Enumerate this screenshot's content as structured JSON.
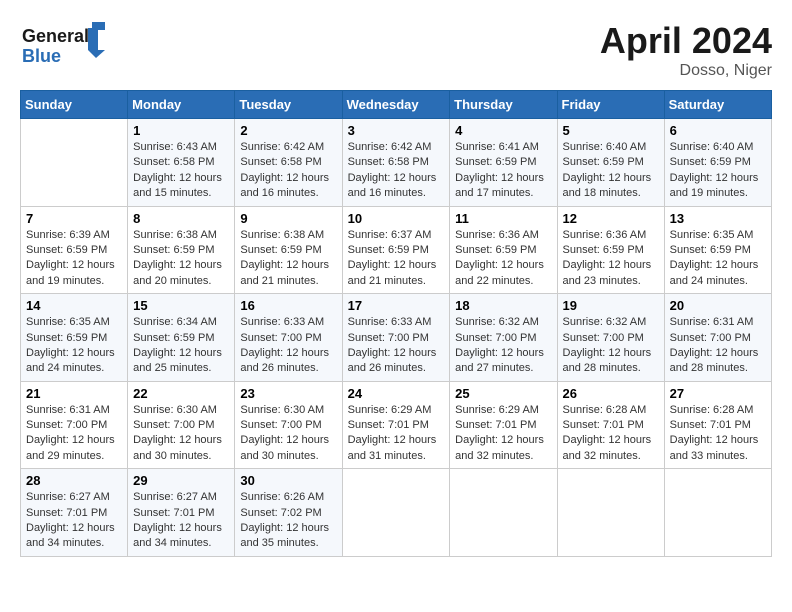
{
  "header": {
    "logo_line1": "General",
    "logo_line2": "Blue",
    "month": "April 2024",
    "location": "Dosso, Niger"
  },
  "days_of_week": [
    "Sunday",
    "Monday",
    "Tuesday",
    "Wednesday",
    "Thursday",
    "Friday",
    "Saturday"
  ],
  "weeks": [
    [
      {
        "day": "",
        "sunrise": "",
        "sunset": "",
        "daylight": ""
      },
      {
        "day": "1",
        "sunrise": "Sunrise: 6:43 AM",
        "sunset": "Sunset: 6:58 PM",
        "daylight": "Daylight: 12 hours and 15 minutes."
      },
      {
        "day": "2",
        "sunrise": "Sunrise: 6:42 AM",
        "sunset": "Sunset: 6:58 PM",
        "daylight": "Daylight: 12 hours and 16 minutes."
      },
      {
        "day": "3",
        "sunrise": "Sunrise: 6:42 AM",
        "sunset": "Sunset: 6:58 PM",
        "daylight": "Daylight: 12 hours and 16 minutes."
      },
      {
        "day": "4",
        "sunrise": "Sunrise: 6:41 AM",
        "sunset": "Sunset: 6:59 PM",
        "daylight": "Daylight: 12 hours and 17 minutes."
      },
      {
        "day": "5",
        "sunrise": "Sunrise: 6:40 AM",
        "sunset": "Sunset: 6:59 PM",
        "daylight": "Daylight: 12 hours and 18 minutes."
      },
      {
        "day": "6",
        "sunrise": "Sunrise: 6:40 AM",
        "sunset": "Sunset: 6:59 PM",
        "daylight": "Daylight: 12 hours and 19 minutes."
      }
    ],
    [
      {
        "day": "7",
        "sunrise": "Sunrise: 6:39 AM",
        "sunset": "Sunset: 6:59 PM",
        "daylight": "Daylight: 12 hours and 19 minutes."
      },
      {
        "day": "8",
        "sunrise": "Sunrise: 6:38 AM",
        "sunset": "Sunset: 6:59 PM",
        "daylight": "Daylight: 12 hours and 20 minutes."
      },
      {
        "day": "9",
        "sunrise": "Sunrise: 6:38 AM",
        "sunset": "Sunset: 6:59 PM",
        "daylight": "Daylight: 12 hours and 21 minutes."
      },
      {
        "day": "10",
        "sunrise": "Sunrise: 6:37 AM",
        "sunset": "Sunset: 6:59 PM",
        "daylight": "Daylight: 12 hours and 21 minutes."
      },
      {
        "day": "11",
        "sunrise": "Sunrise: 6:36 AM",
        "sunset": "Sunset: 6:59 PM",
        "daylight": "Daylight: 12 hours and 22 minutes."
      },
      {
        "day": "12",
        "sunrise": "Sunrise: 6:36 AM",
        "sunset": "Sunset: 6:59 PM",
        "daylight": "Daylight: 12 hours and 23 minutes."
      },
      {
        "day": "13",
        "sunrise": "Sunrise: 6:35 AM",
        "sunset": "Sunset: 6:59 PM",
        "daylight": "Daylight: 12 hours and 24 minutes."
      }
    ],
    [
      {
        "day": "14",
        "sunrise": "Sunrise: 6:35 AM",
        "sunset": "Sunset: 6:59 PM",
        "daylight": "Daylight: 12 hours and 24 minutes."
      },
      {
        "day": "15",
        "sunrise": "Sunrise: 6:34 AM",
        "sunset": "Sunset: 6:59 PM",
        "daylight": "Daylight: 12 hours and 25 minutes."
      },
      {
        "day": "16",
        "sunrise": "Sunrise: 6:33 AM",
        "sunset": "Sunset: 7:00 PM",
        "daylight": "Daylight: 12 hours and 26 minutes."
      },
      {
        "day": "17",
        "sunrise": "Sunrise: 6:33 AM",
        "sunset": "Sunset: 7:00 PM",
        "daylight": "Daylight: 12 hours and 26 minutes."
      },
      {
        "day": "18",
        "sunrise": "Sunrise: 6:32 AM",
        "sunset": "Sunset: 7:00 PM",
        "daylight": "Daylight: 12 hours and 27 minutes."
      },
      {
        "day": "19",
        "sunrise": "Sunrise: 6:32 AM",
        "sunset": "Sunset: 7:00 PM",
        "daylight": "Daylight: 12 hours and 28 minutes."
      },
      {
        "day": "20",
        "sunrise": "Sunrise: 6:31 AM",
        "sunset": "Sunset: 7:00 PM",
        "daylight": "Daylight: 12 hours and 28 minutes."
      }
    ],
    [
      {
        "day": "21",
        "sunrise": "Sunrise: 6:31 AM",
        "sunset": "Sunset: 7:00 PM",
        "daylight": "Daylight: 12 hours and 29 minutes."
      },
      {
        "day": "22",
        "sunrise": "Sunrise: 6:30 AM",
        "sunset": "Sunset: 7:00 PM",
        "daylight": "Daylight: 12 hours and 30 minutes."
      },
      {
        "day": "23",
        "sunrise": "Sunrise: 6:30 AM",
        "sunset": "Sunset: 7:00 PM",
        "daylight": "Daylight: 12 hours and 30 minutes."
      },
      {
        "day": "24",
        "sunrise": "Sunrise: 6:29 AM",
        "sunset": "Sunset: 7:01 PM",
        "daylight": "Daylight: 12 hours and 31 minutes."
      },
      {
        "day": "25",
        "sunrise": "Sunrise: 6:29 AM",
        "sunset": "Sunset: 7:01 PM",
        "daylight": "Daylight: 12 hours and 32 minutes."
      },
      {
        "day": "26",
        "sunrise": "Sunrise: 6:28 AM",
        "sunset": "Sunset: 7:01 PM",
        "daylight": "Daylight: 12 hours and 32 minutes."
      },
      {
        "day": "27",
        "sunrise": "Sunrise: 6:28 AM",
        "sunset": "Sunset: 7:01 PM",
        "daylight": "Daylight: 12 hours and 33 minutes."
      }
    ],
    [
      {
        "day": "28",
        "sunrise": "Sunrise: 6:27 AM",
        "sunset": "Sunset: 7:01 PM",
        "daylight": "Daylight: 12 hours and 34 minutes."
      },
      {
        "day": "29",
        "sunrise": "Sunrise: 6:27 AM",
        "sunset": "Sunset: 7:01 PM",
        "daylight": "Daylight: 12 hours and 34 minutes."
      },
      {
        "day": "30",
        "sunrise": "Sunrise: 6:26 AM",
        "sunset": "Sunset: 7:02 PM",
        "daylight": "Daylight: 12 hours and 35 minutes."
      },
      {
        "day": "",
        "sunrise": "",
        "sunset": "",
        "daylight": ""
      },
      {
        "day": "",
        "sunrise": "",
        "sunset": "",
        "daylight": ""
      },
      {
        "day": "",
        "sunrise": "",
        "sunset": "",
        "daylight": ""
      },
      {
        "day": "",
        "sunrise": "",
        "sunset": "",
        "daylight": ""
      }
    ]
  ]
}
